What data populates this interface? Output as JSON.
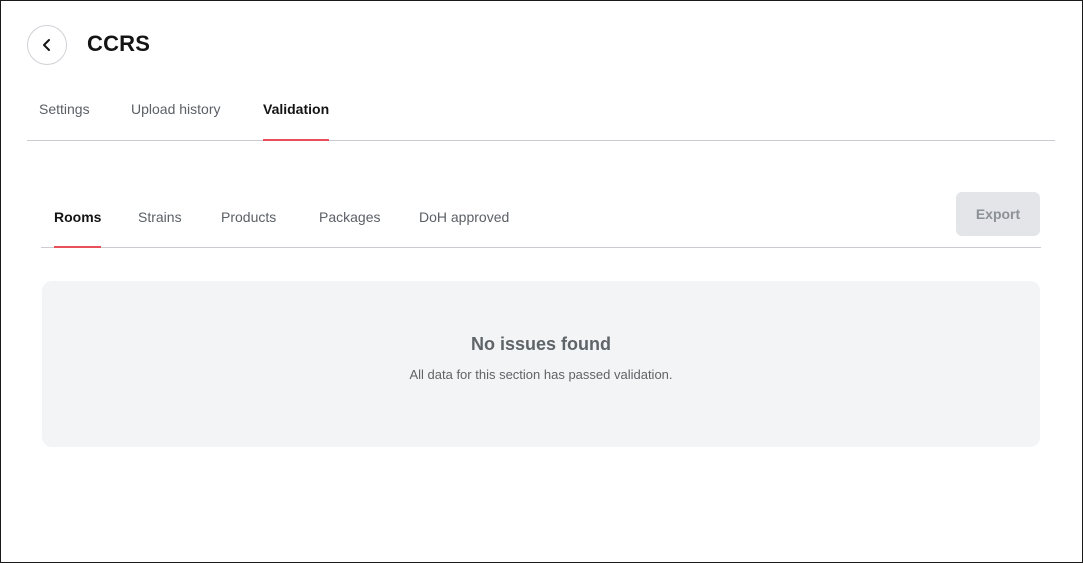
{
  "header": {
    "back_icon": "chevron-left-icon",
    "title": "CCRS"
  },
  "top_tabs": [
    {
      "label": "Settings",
      "active": false
    },
    {
      "label": "Upload history",
      "active": false
    },
    {
      "label": "Validation",
      "active": true
    }
  ],
  "sub_tabs": [
    {
      "label": "Rooms",
      "active": true
    },
    {
      "label": "Strains",
      "active": false
    },
    {
      "label": "Products",
      "active": false
    },
    {
      "label": "Packages",
      "active": false
    },
    {
      "label": "DoH approved",
      "active": false
    }
  ],
  "toolbar": {
    "export_label": "Export",
    "export_disabled": true
  },
  "empty_state": {
    "title": "No issues found",
    "description": "All data for this section has passed validation."
  },
  "colors": {
    "accent": "#e8505b",
    "panel_bg": "#f3f4f5",
    "divider": "#c9ccd0"
  }
}
